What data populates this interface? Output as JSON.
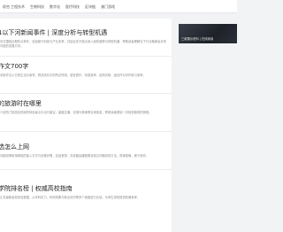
{
  "nav": {
    "items": [
      "综合",
      "工程技术",
      "生物科技",
      "数字化",
      "医疗科技",
      "区块链",
      "澳门游戏"
    ]
  },
  "articles": [
    {
      "title": "1以下河新闻事件 | 深度分析与转型机遇",
      "summary": "本文围绕近期热点事件，包括新兴科技与产业变革，并结合多方观点深入剖析趋势与转型机遇，帮助读者理解当下行业格局及未来可能的发展方向。"
    },
    {
      "title": "作文700字",
      "summary": "本篇作文以日常生活为素材，叙述成长中的所见所感，语言质朴、情感真挚，结构清晰，适合作为写作练习参考。"
    },
    {
      "title": "的旅游时在哪里",
      "summary": "介绍热门旅游目的地的特色景点与出行建议，涵盖交通、住宿与美食等实用信息，帮助读者规划一次轻松愉快的旅程。"
    },
    {
      "title": "选怎么上网",
      "summary": "详细说明家用网络的接入方式与设置步骤，包括宽带、无线路由器配置及常见问题排查方法，简单易懂，便于操作。"
    },
    {
      "title": "学院排名榜 | 权威高校指南",
      "summary": "汇总最新高校排名数据，从学科实力、科研成果与就业情况等多个维度进行比较，为考生择校提供权威参考。"
    }
  ],
  "sidebar": {
    "banner_caption": "三维展示资料 | 在线阅读"
  }
}
